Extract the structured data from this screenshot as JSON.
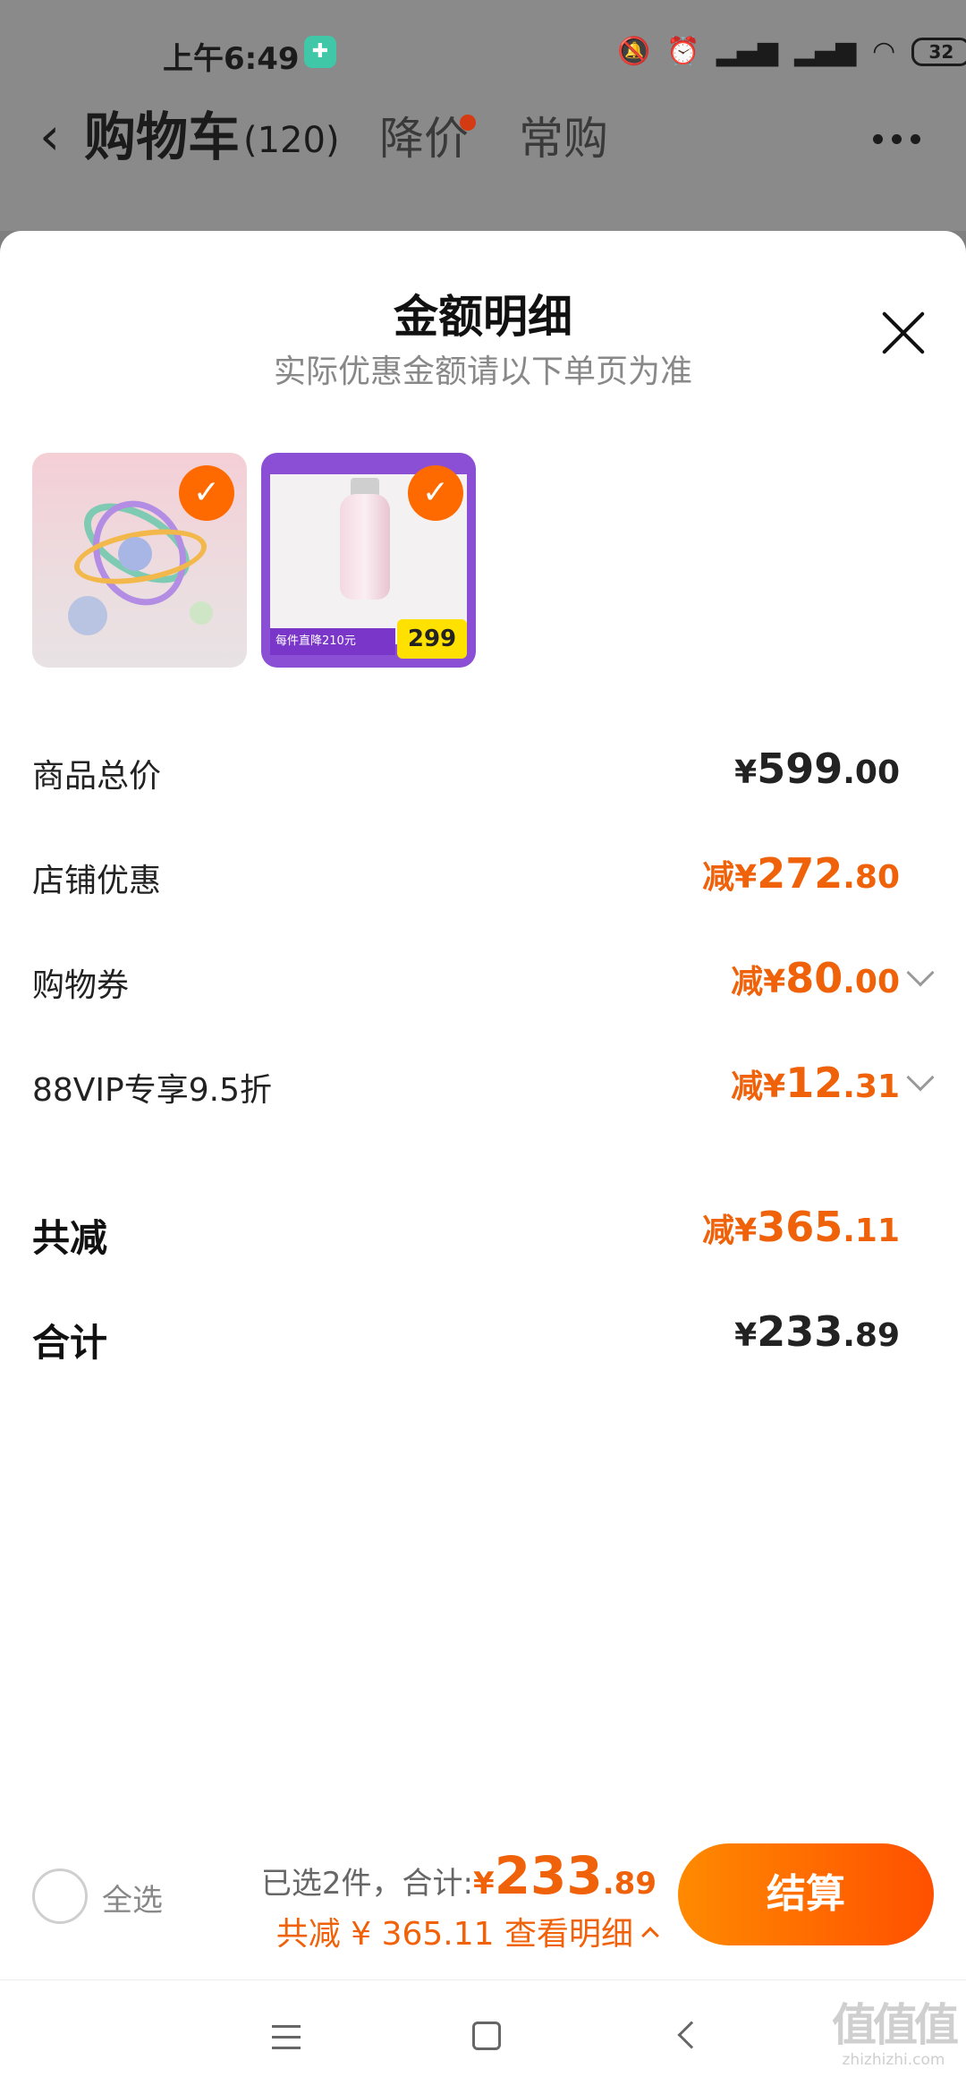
{
  "status_bar": {
    "time": "上午6:49",
    "battery": "32",
    "icons": [
      "bell-off-icon",
      "alarm-icon",
      "signal-hd-icon",
      "signal-hd-icon",
      "wifi-icon",
      "battery-icon"
    ]
  },
  "nav": {
    "title": "购物车",
    "count": "(120)",
    "tabs": [
      {
        "label": "降价",
        "has_dot": true
      },
      {
        "label": "常购",
        "has_dot": false
      }
    ]
  },
  "sheet": {
    "title": "金额明细",
    "subtitle": "实际优惠金额请以下单页为准",
    "thumb2": {
      "bar_text": "每件直降210元",
      "price": "299"
    },
    "rows": [
      {
        "label": "商品总价",
        "prefix": "",
        "currency": "¥",
        "integer": "599",
        "decimal": ".00",
        "highlight": false,
        "expandable": false
      },
      {
        "label": "店铺优惠",
        "prefix": "减",
        "currency": "¥",
        "integer": "272",
        "decimal": ".80",
        "highlight": true,
        "expandable": false
      },
      {
        "label": "购物券",
        "prefix": "减",
        "currency": "¥",
        "integer": "80",
        "decimal": ".00",
        "highlight": true,
        "expandable": true
      },
      {
        "label": "88VIP专享9.5折",
        "prefix": "减",
        "currency": "¥",
        "integer": "12",
        "decimal": ".31",
        "highlight": true,
        "expandable": true
      }
    ],
    "total_discount": {
      "label": "共减",
      "prefix": "减",
      "currency": "¥",
      "integer": "365",
      "decimal": ".11"
    },
    "grand_total": {
      "label": "合计",
      "currency": "¥",
      "integer": "233",
      "decimal": ".89"
    }
  },
  "bottom_bar": {
    "select_all_label": "全选",
    "selected_text": "已选2件，合计:",
    "total_currency": "¥",
    "total_integer": "233",
    "total_decimal": ".89",
    "discount_text": "共减 ¥ 365.11 查看明细",
    "checkout_label": "结算"
  },
  "watermark": {
    "logo": "值值值",
    "url": "zhizhizhi.com"
  },
  "colors": {
    "accent": "#f0620a",
    "checkout_gradient": [
      "#ff8a00",
      "#ff5000"
    ]
  }
}
